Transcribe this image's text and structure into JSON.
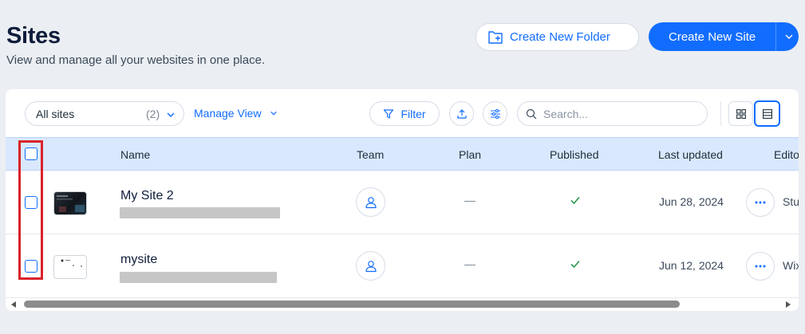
{
  "header": {
    "title": "Sites",
    "subtitle": "View and manage all your websites in one place.",
    "create_folder_label": "Create New Folder",
    "create_site_label": "Create New Site"
  },
  "toolbar": {
    "sites_filter_value": "All sites",
    "sites_count": "(2)",
    "manage_view_label": "Manage View",
    "filter_label": "Filter",
    "search_placeholder": "Search..."
  },
  "table": {
    "columns": {
      "name": "Name",
      "team": "Team",
      "plan": "Plan",
      "published": "Published",
      "last_updated": "Last updated",
      "editor": "Edito"
    },
    "rows": [
      {
        "name": "My Site 2",
        "plan": "—",
        "last_updated": "Jun 28, 2024",
        "editor": "Stu",
        "thumbnail": "dark-website-preview",
        "published": true
      },
      {
        "name": "mysite",
        "plan": "—",
        "last_updated": "Jun 12, 2024",
        "editor": "Wix",
        "thumbnail": "blank-website-preview",
        "published": true
      }
    ]
  },
  "colors": {
    "accent": "#116dff",
    "header_row": "#d9e8fe",
    "highlight": "#d9222a",
    "published_check": "#2b9b4a"
  }
}
